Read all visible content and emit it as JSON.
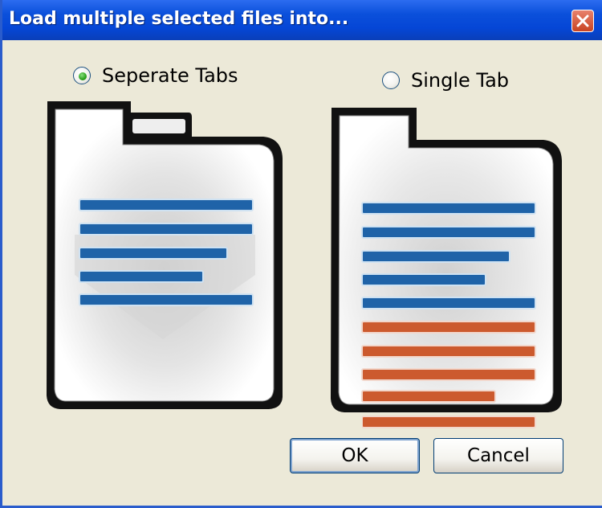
{
  "dialog": {
    "title": "Load multiple selected files into...",
    "close_icon": "close-icon"
  },
  "options": [
    {
      "label": "Seperate Tabs",
      "selected": true
    },
    {
      "label": "Single Tab",
      "selected": false
    }
  ],
  "illustrations": {
    "separate_tabs": {
      "blue_lines": 5,
      "orange_lines": 0
    },
    "single_tab": {
      "blue_lines": 5,
      "orange_lines": 5
    }
  },
  "buttons": {
    "ok_label": "OK",
    "cancel_label": "Cancel"
  },
  "colors": {
    "titlebar": "#0546d6",
    "close_button": "#c84322",
    "radio_selected": "#2aa11b",
    "line_blue": "#1f63a8",
    "line_orange": "#cc5a2e",
    "background": "#ece9d8"
  }
}
